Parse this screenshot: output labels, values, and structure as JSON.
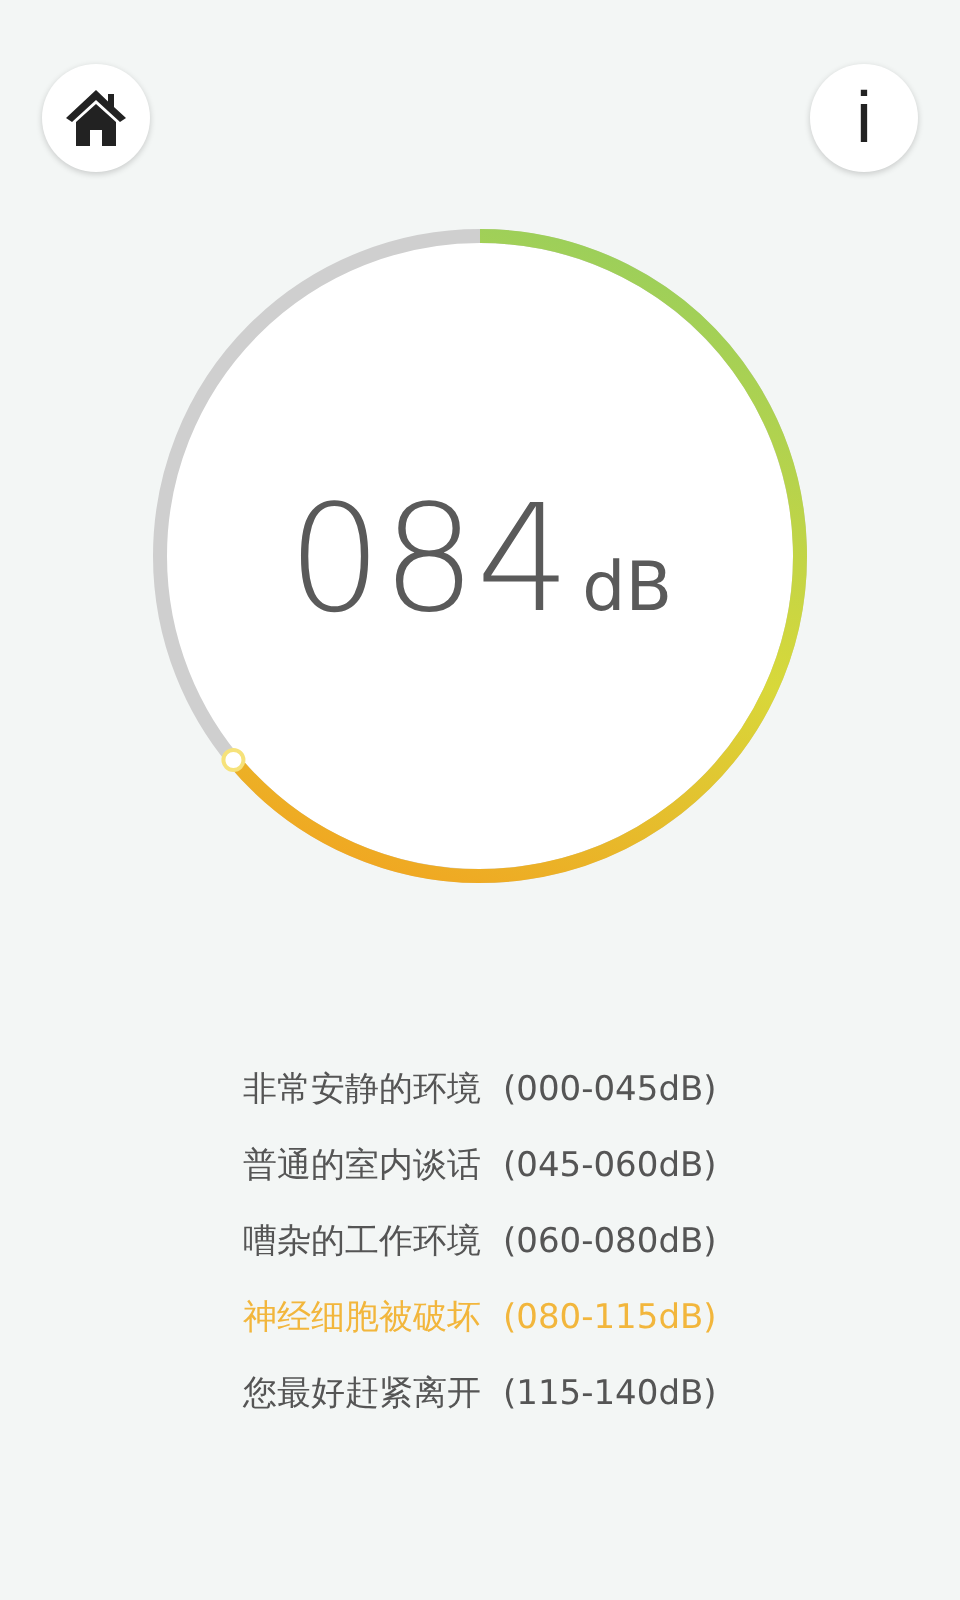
{
  "toolbar": {
    "home_button": {
      "kind": "home"
    },
    "info_button": {
      "label": "i"
    }
  },
  "meter": {
    "value": "084",
    "unit": "dB"
  },
  "levels": [
    {
      "label": "非常安静的环境",
      "range": "(000-045dB)",
      "selected": false
    },
    {
      "label": "普通的室内谈话",
      "range": "(045-060dB)",
      "selected": false
    },
    {
      "label": "嘈杂的工作环境",
      "range": "(060-080dB)",
      "selected": false
    },
    {
      "label": "神经细胞被破坏",
      "range": "(080-115dB)",
      "selected": true
    },
    {
      "label": "您最好赶紧离开",
      "range": "(115-140dB)",
      "selected": false
    }
  ]
}
